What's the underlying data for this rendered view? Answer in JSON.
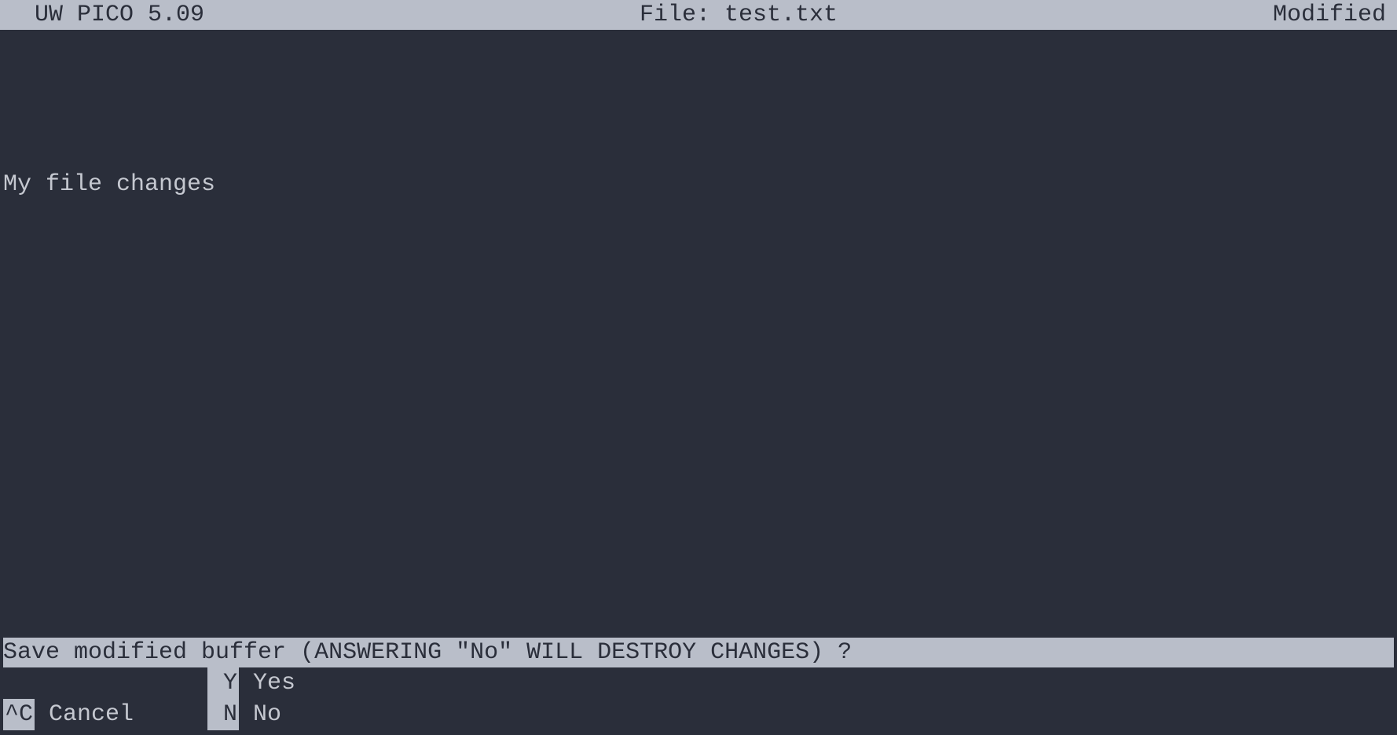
{
  "titlebar": {
    "app_name": "UW PICO 5.09",
    "file_label": "File: test.txt",
    "status": "Modified"
  },
  "editor": {
    "content_line": "My file changes"
  },
  "prompt": {
    "text": "Save modified buffer (ANSWERING \"No\" WILL DESTROY CHANGES) ? "
  },
  "shortcuts": {
    "row1": {
      "col2_key": " Y",
      "col2_label": " Yes"
    },
    "row2": {
      "col1_key": "^C",
      "col1_label": " Cancel",
      "col2_key": " N",
      "col2_label": " No"
    }
  }
}
